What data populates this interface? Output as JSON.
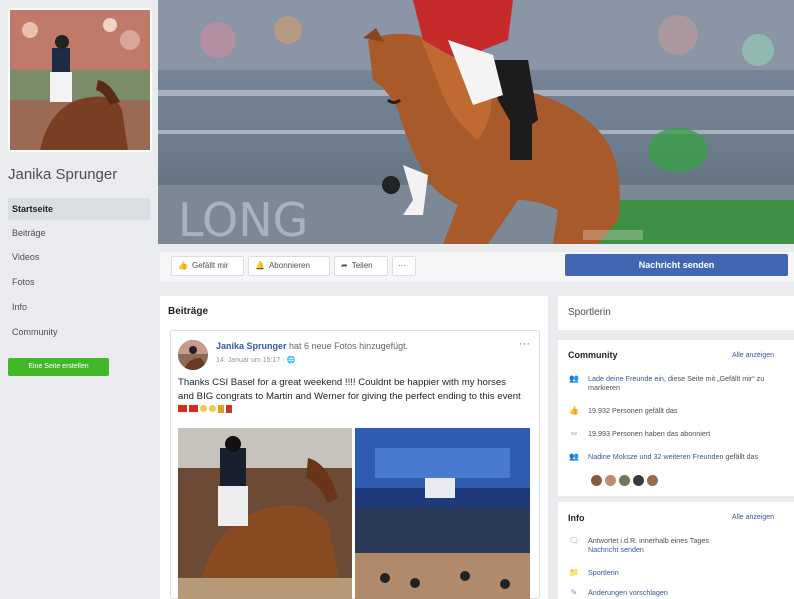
{
  "page": {
    "name": "Janika Sprunger",
    "create_button": "Eine Seite erstellen"
  },
  "nav": [
    {
      "label": "Startseite",
      "active": true
    },
    {
      "label": "Beiträge"
    },
    {
      "label": "Videos"
    },
    {
      "label": "Fotos"
    },
    {
      "label": "Info"
    },
    {
      "label": "Community"
    }
  ],
  "actions": {
    "like": "Gefällt mir",
    "subscribe": "Abonnieren",
    "share": "Teilen",
    "more": "···",
    "message": "Nachricht senden"
  },
  "posts": {
    "title": "Beiträge",
    "post": {
      "author": "Janika Sprunger",
      "action": "hat 6 neue Fotos hinzugefügt.",
      "meta": "14. Januar um 15:17 · ",
      "more": "···",
      "text": "Thanks CSI Basel for a great weekend !!!! Couldnt be happier with my horses and BIG congrats to Martin and Werner for giving the perfect ending to this event"
    }
  },
  "right": {
    "category": "Sportlerin",
    "community": {
      "title": "Community",
      "see_all": "Alle anzeigen",
      "invite_prefix": "Lade deine Freunde ein,",
      "invite_suffix": "diese Seite mit „Gefällt mir“ zu markieren",
      "likes": "19.932 Personen gefällt das",
      "follows": "19.993 Personen haben das abonniert",
      "friends_prefix": "Nadine Moksze und 32 weiteren Freunden",
      "friends_suffix": "gefällt das"
    },
    "info": {
      "title": "Info",
      "see_all": "Alle anzeigen",
      "response": "Antwortet i.d.R. innerhalb eines Tages",
      "response_link": "Nachricht senden",
      "category": "Sportlerin",
      "suggest": "Änderungen vorschlagen"
    }
  },
  "icons": {
    "like": "thumbs-up-icon",
    "subscribe": "subscribe-icon",
    "share": "share-icon",
    "invite": "people-icon",
    "likes": "thumbs-up-icon",
    "follows": "rss-icon",
    "friends": "people-icon",
    "response": "chat-icon",
    "category": "folder-icon",
    "suggest": "pencil-icon"
  },
  "colors": {
    "brand": "#4267b2",
    "link": "#385898",
    "create_green": "#42b72a",
    "background": "#e9ebee"
  }
}
